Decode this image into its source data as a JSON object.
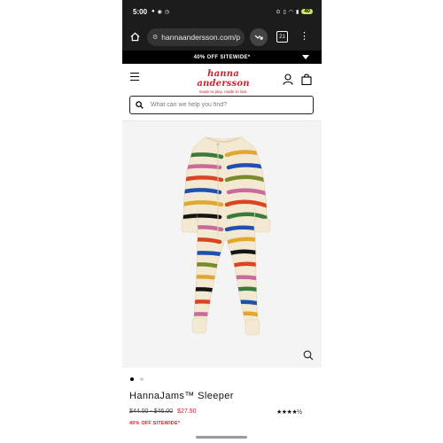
{
  "status_bar": {
    "time": "5:00",
    "battery": "40"
  },
  "browser": {
    "url": "hannaandersson.com/p",
    "tab_count": "21"
  },
  "promo": {
    "banner": "40% OFF SITEWIDE*"
  },
  "header": {
    "logo_text": "hanna andersson",
    "logo_tagline": "made to play. made to last."
  },
  "search": {
    "placeholder": "What can we help you find?"
  },
  "product": {
    "name": "HannaJams™ Sleeper",
    "price_original": "$44.00 - $46.00",
    "price_sale": "$27.50",
    "rating_stars": "★★★★½",
    "promo_note": "40% OFF SITEWIDE*",
    "image_slides": 2,
    "active_slide": 1
  },
  "colors": {
    "brand_red": "#d0202f",
    "chrome_dark": "#1c1c1c",
    "sleeper_base": "#f3e9d2"
  }
}
